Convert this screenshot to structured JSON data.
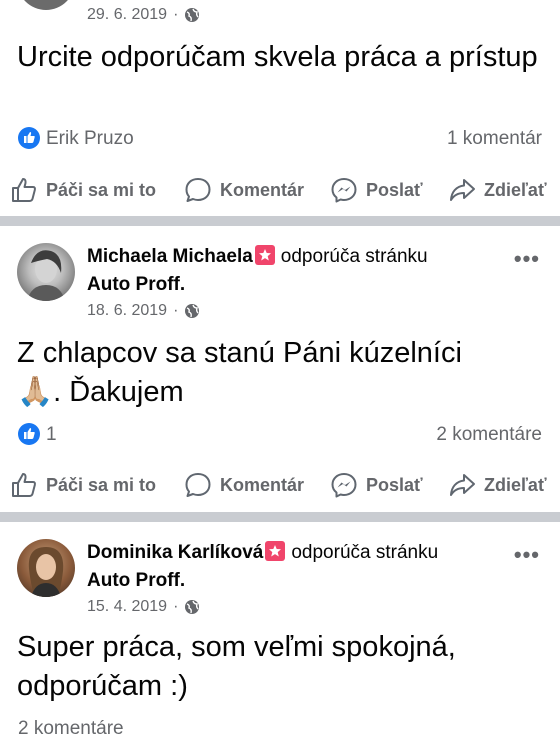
{
  "posts": [
    {
      "date": "29. 6. 2019",
      "dot": "·",
      "text": "Urcite odporúčam skvela práca a prístup",
      "likes": "Erik Pruzo",
      "comments": "1 komentár"
    },
    {
      "author": "Michaela Michaela",
      "rec_label": "odporúča stránku",
      "page": "Auto Proff.",
      "date": "18. 6. 2019",
      "dot": "·",
      "text_a": "Z chlapcov sa stanú Páni kúzelníci",
      "emoji": "🙏🏼",
      "text_b": ". Ďakujem",
      "likes": "1",
      "comments": "2 komentáre"
    },
    {
      "author": "Dominika Karlíková",
      "rec_label": "odporúča stránku",
      "page": "Auto Proff.",
      "date": "15. 4. 2019",
      "dot": "·",
      "text": "Super práca, som veľmi spokojná, odporúčam :)",
      "comments": "2 komentáre"
    }
  ],
  "actions": {
    "like": "Páči sa mi to",
    "comment": "Komentár",
    "send": "Poslať",
    "share": "Zdieľať"
  },
  "more_label": "•••",
  "colors": {
    "accent": "#1877f2",
    "badge": "#f0456b",
    "secondary_text": "#65676b",
    "divider": "#c9ccd1"
  }
}
